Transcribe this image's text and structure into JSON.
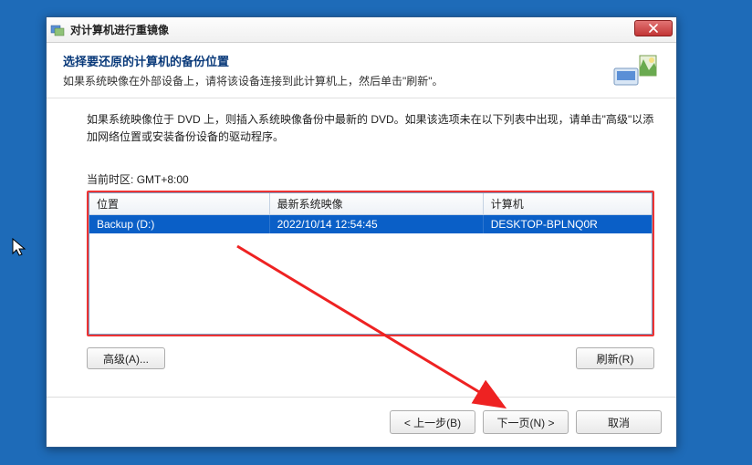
{
  "titlebar": {
    "title": "对计算机进行重镜像"
  },
  "header": {
    "title": "选择要还原的计算机的备份位置",
    "subtitle": "如果系统映像在外部设备上，请将该设备连接到此计算机上，然后单击\"刷新\"。"
  },
  "instruction": "如果系统映像位于 DVD 上，则插入系统映像备份中最新的 DVD。如果该选项未在以下列表中出现，请单击\"高级\"以添加网络位置或安装备份设备的驱动程序。",
  "timezone": {
    "label": "当前时区:",
    "value": "GMT+8:00"
  },
  "table": {
    "headers": {
      "location": "位置",
      "latest_image": "最新系统映像",
      "computer": "计算机"
    },
    "rows": [
      {
        "location": "Backup (D:)",
        "latest_image": "2022/10/14 12:54:45",
        "computer": "DESKTOP-BPLNQ0R"
      }
    ]
  },
  "buttons": {
    "advanced": "高级(A)...",
    "refresh": "刷新(R)",
    "back": "< 上一步(B)",
    "next": "下一页(N) >",
    "cancel": "取消"
  }
}
